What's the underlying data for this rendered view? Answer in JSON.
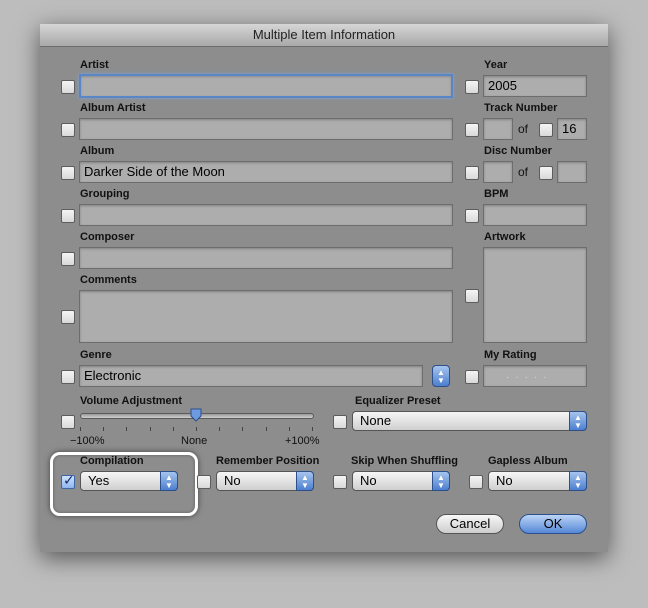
{
  "window": {
    "title": "Multiple Item Information"
  },
  "fields": {
    "artist": {
      "label": "Artist",
      "value": ""
    },
    "year": {
      "label": "Year",
      "value": "2005"
    },
    "album_artist": {
      "label": "Album Artist",
      "value": ""
    },
    "track_number": {
      "label": "Track Number",
      "value": "",
      "of": "of",
      "total": "16"
    },
    "album": {
      "label": "Album",
      "value": "Darker Side of the Moon"
    },
    "disc_number": {
      "label": "Disc Number",
      "value": "",
      "of": "of",
      "total": ""
    },
    "grouping": {
      "label": "Grouping",
      "value": ""
    },
    "bpm": {
      "label": "BPM",
      "value": ""
    },
    "composer": {
      "label": "Composer",
      "value": ""
    },
    "artwork": {
      "label": "Artwork"
    },
    "comments": {
      "label": "Comments",
      "value": ""
    },
    "genre": {
      "label": "Genre",
      "value": "Electronic"
    },
    "my_rating": {
      "label": "My Rating",
      "stars": 0,
      "max": 5
    }
  },
  "volume": {
    "label": "Volume Adjustment",
    "min_label": "−100%",
    "mid_label": "None",
    "max_label": "+100%",
    "value_percent": 0
  },
  "equalizer": {
    "label": "Equalizer Preset",
    "value": "None"
  },
  "compilation": {
    "label": "Compilation",
    "value": "Yes",
    "checked": true
  },
  "remember_position": {
    "label": "Remember Position",
    "value": "No"
  },
  "skip_when_shuffling": {
    "label": "Skip When Shuffling",
    "value": "No"
  },
  "gapless_album": {
    "label": "Gapless Album",
    "value": "No"
  },
  "buttons": {
    "cancel": "Cancel",
    "ok": "OK"
  },
  "colors": {
    "accent": "#5588d6",
    "dialog_bg": "#8d8d8d",
    "highlight": "#ffffff"
  }
}
